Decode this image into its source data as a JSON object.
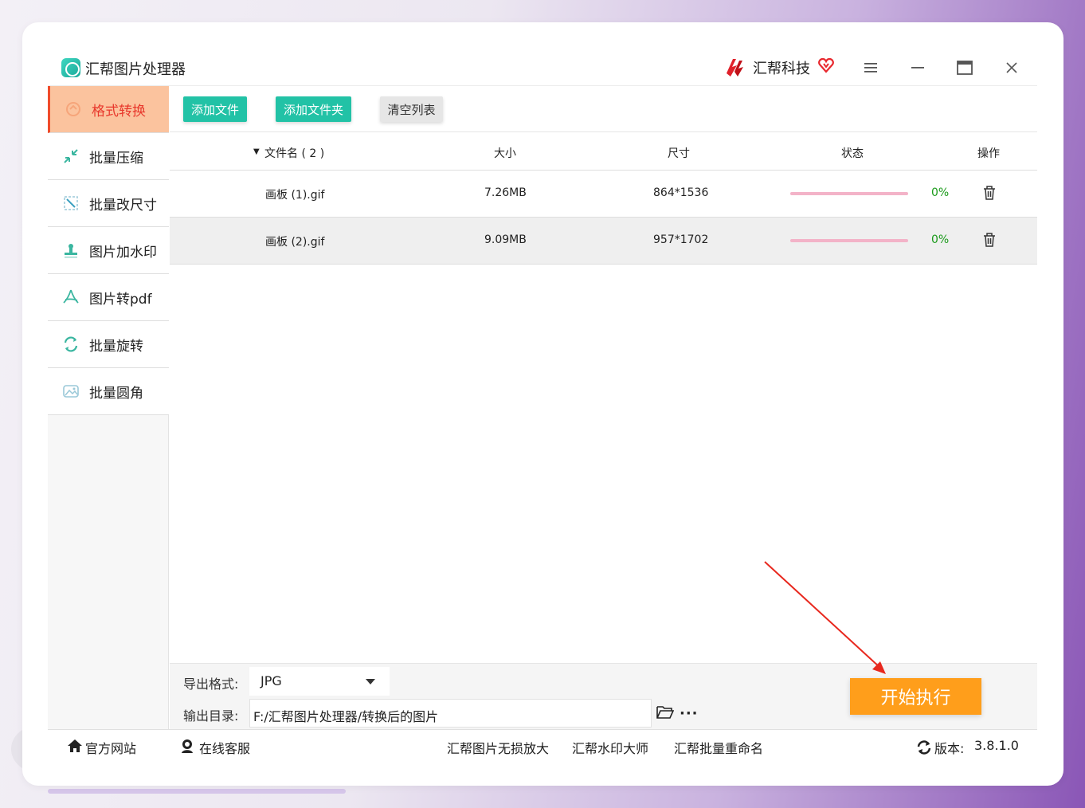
{
  "window": {
    "title": "汇帮图片处理器",
    "brand": "汇帮科技",
    "controls": [
      "menu-icon",
      "minimize-icon",
      "maximize-icon",
      "close-icon"
    ]
  },
  "sidebar": {
    "items": [
      {
        "label": "格式转换",
        "icon": "format-convert-icon",
        "active": true
      },
      {
        "label": "批量压缩",
        "icon": "compress-icon",
        "active": false
      },
      {
        "label": "批量改尺寸",
        "icon": "resize-icon",
        "active": false
      },
      {
        "label": "图片加水印",
        "icon": "watermark-icon",
        "active": false
      },
      {
        "label": "图片转pdf",
        "icon": "pdf-icon",
        "active": false
      },
      {
        "label": "批量旋转",
        "icon": "rotate-icon",
        "active": false
      },
      {
        "label": "批量圆角",
        "icon": "round-corner-icon",
        "active": false
      }
    ]
  },
  "toolbar": {
    "add_file": "添加文件",
    "add_folder": "添加文件夹",
    "clear_list": "清空列表"
  },
  "table": {
    "headers": {
      "filename": "文件名 ( 2 )",
      "size": "大小",
      "dimensions": "尺寸",
      "status": "状态",
      "action": "操作"
    },
    "rows": [
      {
        "filename": "画板 (1).gif",
        "size": "7.26MB",
        "dimensions": "864*1536",
        "progress": "0%"
      },
      {
        "filename": "画板 (2).gif",
        "size": "9.09MB",
        "dimensions": "957*1702",
        "progress": "0%"
      }
    ]
  },
  "settings": {
    "format_label": "导出格式:",
    "format_value": "JPG",
    "output_label": "输出目录:",
    "output_path": "F:/汇帮图片处理器/转换后的图片",
    "more": "···",
    "start_button": "开始执行"
  },
  "footer": {
    "website": "官方网站",
    "support": "在线客服",
    "link1": "汇帮图片无损放大",
    "link2": "汇帮水印大师",
    "link3": "汇帮批量重命名",
    "version_label": "版本:",
    "version": "3.8.1.0"
  },
  "colors": {
    "accent_green": "#22c2a6",
    "active_nav_bg": "#fbc39e",
    "active_nav_text": "#e8382c",
    "start_button": "#ff9e1b",
    "progress_bar": "#f3b3c8",
    "progress_text": "#1a9a1a"
  }
}
